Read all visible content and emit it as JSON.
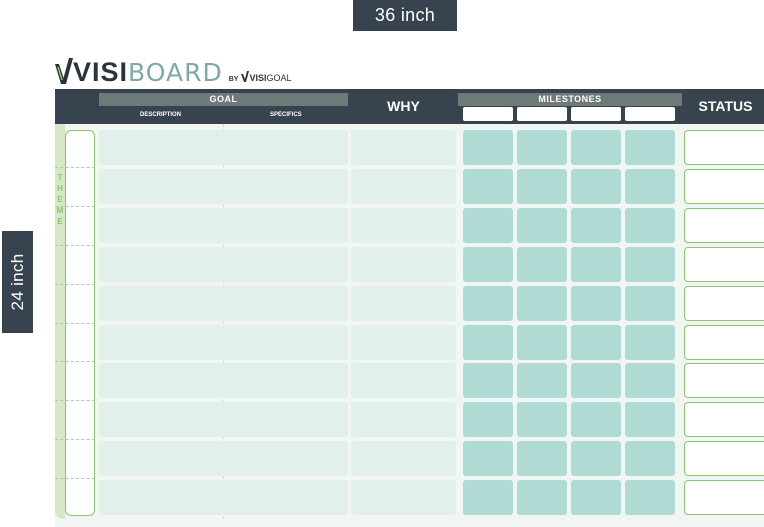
{
  "dimensions": {
    "width_label": "36 inch",
    "height_label": "24 inch"
  },
  "logo": {
    "brand_dark": "VISI",
    "brand_light": "BOARD",
    "by_text": "BY",
    "sub_brand_dark": "VISI",
    "sub_brand_light": "GOAL"
  },
  "header": {
    "goal": "GOAL",
    "description": "DESCRIPTION",
    "specifics": "SPECIFICS",
    "why": "WHY",
    "milestones": "MILESTONES",
    "status": "STATUS"
  },
  "theme": {
    "label": "THEME"
  },
  "grid": {
    "row_count": 10,
    "milestone_columns": 4
  },
  "colors": {
    "header_bg": "#37444f",
    "header_bar": "#6e7a77",
    "goal_cell": "#e2f0ec",
    "milestone_cell": "#b0dbd4",
    "accent_green": "#8cc66b",
    "theme_band": "#d5e8c6"
  }
}
